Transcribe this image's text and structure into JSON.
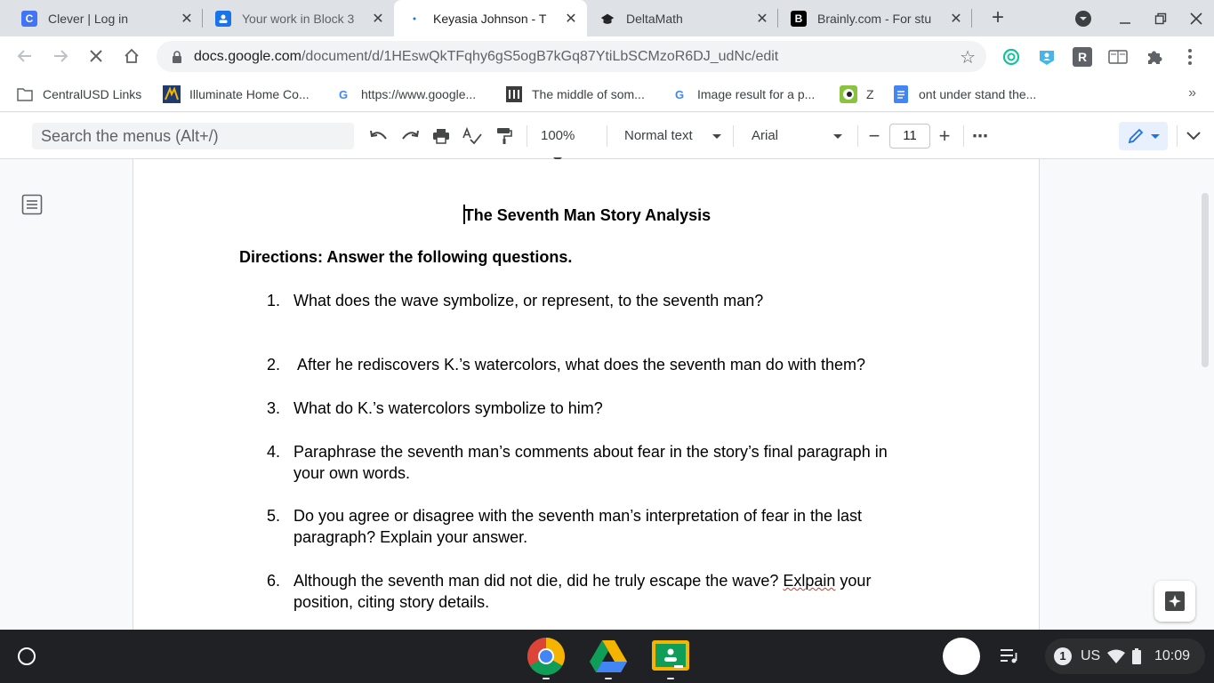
{
  "browser": {
    "tabs": [
      {
        "title": "Clever | Log in",
        "favicon": "clever-icon",
        "favicon_letter": "C",
        "color": "#4274f6",
        "active": false
      },
      {
        "title": "Your work in Block 3",
        "favicon": "classroom-icon",
        "favicon_letter": "",
        "color": "#1a73e8",
        "active": false
      },
      {
        "title": "Keyasia Johnson - T",
        "favicon": "loading-icon",
        "favicon_letter": "",
        "color": "#1a73e8",
        "active": true
      },
      {
        "title": "DeltaMath",
        "favicon": "deltamath-icon",
        "favicon_letter": "",
        "color": "#202124",
        "active": false
      },
      {
        "title": "Brainly.com - For stu",
        "favicon": "brainly-icon",
        "favicon_letter": "B",
        "color": "#000000",
        "active": false
      }
    ],
    "url_host": "docs.google.com",
    "url_path": "/document/d/1HEswQkTFqhy6gS5ogB7kGq87YtiLbSCMzoR6DJ_udNc/edit",
    "extensions": [
      "grammarly-icon",
      "user-extension-icon",
      "r-extension-icon",
      "reader-icon",
      "puzzle-icon",
      "more-vert-icon"
    ],
    "bookmarks": [
      {
        "label": "CentralUSD Links",
        "icon": "folder-icon"
      },
      {
        "label": "Illuminate Home Co...",
        "icon": "illuminate-icon"
      },
      {
        "label": "https://www.google...",
        "icon": "google-icon"
      },
      {
        "label": "The middle of som...",
        "icon": "museum-icon"
      },
      {
        "label": "Image result for a p...",
        "icon": "google-icon"
      },
      {
        "label": "Z",
        "icon": "z-icon"
      },
      {
        "label": "ont under stand the...",
        "icon": "docs-icon"
      }
    ],
    "bookmarks_more": "»"
  },
  "docs_toolbar": {
    "search_placeholder": "Search the menus (Alt+/)",
    "zoom": "100%",
    "style": "Normal text",
    "font": "Arial",
    "font_size": "11",
    "minus": "−",
    "plus": "+",
    "more": "⋯"
  },
  "document": {
    "title": "The Seventh Man Story Analysis",
    "directions": "Directions: Answer the following questions.",
    "questions": [
      {
        "num": "1.",
        "text": "What does the wave symbolize, or represent, to the seventh man?"
      },
      {
        "num": "2.",
        "text": " After he rediscovers K.’s watercolors, what does the seventh man do with them?"
      },
      {
        "num": "3.",
        "text": "What do K.’s watercolors symbolize to him?"
      },
      {
        "num": "4.",
        "text": "Paraphrase the seventh man’s comments about fear in the story’s final paragraph in your own words."
      },
      {
        "num": "5.",
        "text": "Do you agree or disagree with the seventh man’s interpretation of fear in the last paragraph? Explain your answer."
      },
      {
        "num": "6.",
        "text_before": "Although the seventh man did not die, did he truly escape the wave? ",
        "misspelled": "Exlpain",
        "text_after": " your position, citing story details."
      }
    ]
  },
  "shelf": {
    "apps": [
      "chrome-icon",
      "drive-icon",
      "classroom-icon"
    ],
    "notification_count": "1",
    "keyboard": "US",
    "time": "10:09"
  }
}
